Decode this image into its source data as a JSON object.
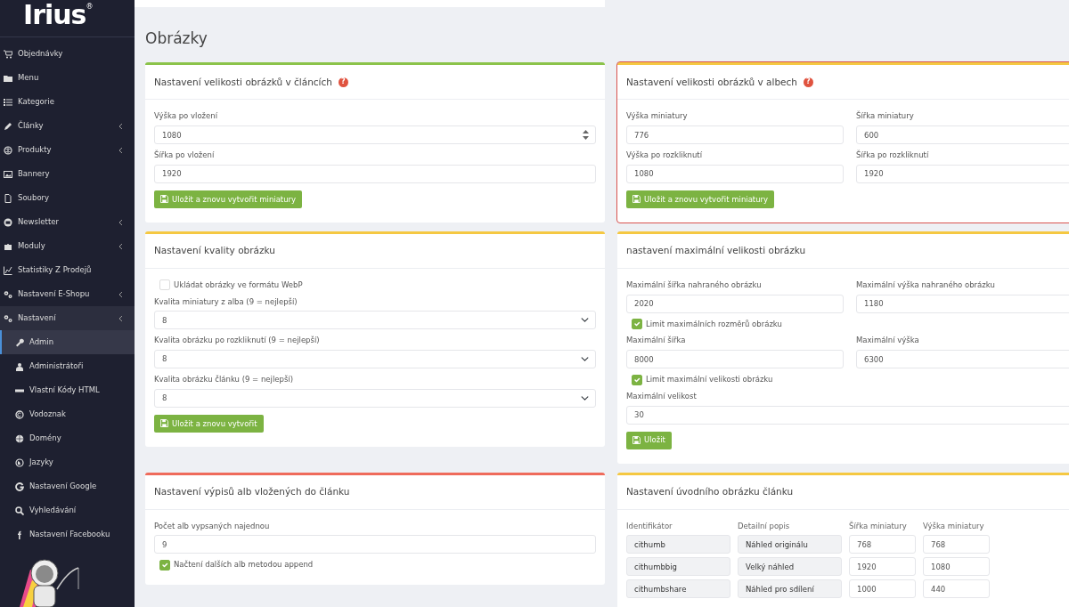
{
  "sidebar": {
    "logo": "Irius",
    "logo_mark": "®",
    "items": [
      {
        "label": "Objednávky",
        "has_submenu": false,
        "expanded": false,
        "selected": false
      },
      {
        "label": "Menu",
        "has_submenu": false,
        "expanded": false,
        "selected": false
      },
      {
        "label": "Kategorie",
        "has_submenu": false,
        "expanded": false,
        "selected": false
      },
      {
        "label": "Články",
        "has_submenu": true,
        "expanded": false,
        "selected": false
      },
      {
        "label": "Produkty",
        "has_submenu": true,
        "expanded": false,
        "selected": false
      },
      {
        "label": "Bannery",
        "has_submenu": false,
        "expanded": false,
        "selected": false
      },
      {
        "label": "Soubory",
        "has_submenu": false,
        "expanded": false,
        "selected": false
      },
      {
        "label": "Newsletter",
        "has_submenu": true,
        "expanded": false,
        "selected": false
      },
      {
        "label": "Moduly",
        "has_submenu": true,
        "expanded": false,
        "selected": false
      },
      {
        "label": "Statistiky Z Prodejů",
        "has_submenu": false,
        "expanded": false,
        "selected": false
      },
      {
        "label": "Nastavení E-Shopu",
        "has_submenu": true,
        "expanded": false,
        "selected": false
      },
      {
        "label": "Nastavení",
        "has_submenu": true,
        "expanded": true,
        "selected": false,
        "children": [
          {
            "label": "Admin",
            "selected": true
          },
          {
            "label": "Administrátoři",
            "selected": false
          },
          {
            "label": "Vlastní Kódy HTML",
            "selected": false
          },
          {
            "label": "Vodoznak",
            "selected": false
          },
          {
            "label": "Domény",
            "selected": false
          },
          {
            "label": "Jazyky",
            "selected": false
          },
          {
            "label": "Nastavení Google",
            "selected": false
          },
          {
            "label": "Vyhledávání",
            "selected": false
          },
          {
            "label": "Nastavení Facebooku",
            "selected": false
          }
        ]
      }
    ]
  },
  "page_title": "Obrázky",
  "cards": [
    {
      "title": "Nastavení velikosti obrázků v článcích",
      "help": "?",
      "color": "#8bc34a",
      "highlighted": false,
      "items": [
        {
          "kind": "number",
          "label": "Výška po vložení",
          "value": "1080"
        },
        {
          "kind": "input",
          "label": "Šířka po vložení",
          "value": "1920"
        },
        {
          "kind": "button",
          "label": "Uložit a znovu vytvořit miniatury"
        }
      ]
    },
    {
      "title": "Nastavení velikosti obrázků v albech",
      "help": "?",
      "color": "#f5c842",
      "highlighted": true,
      "items": [
        {
          "kind": "row",
          "fields": [
            {
              "kind": "input",
              "label": "Výška miniatury",
              "value": "776"
            },
            {
              "kind": "input",
              "label": "Šířka miniatury",
              "value": "600"
            }
          ]
        },
        {
          "kind": "row",
          "fields": [
            {
              "kind": "input",
              "label": "Výška po rozkliknutí",
              "value": "1080"
            },
            {
              "kind": "input",
              "label": "Šířka po rozkliknutí",
              "value": "1920"
            }
          ]
        },
        {
          "kind": "button",
          "label": "Uložit a znovu vytvořit miniatury"
        }
      ]
    },
    {
      "title": "Nastavení kvality obrázku",
      "color": "#f5c842",
      "highlighted": false,
      "items": [
        {
          "kind": "checkbox",
          "label": "Ukládat obrázky ve formátu WebP",
          "checked": false
        },
        {
          "kind": "select",
          "label": "Kvalita miniatury z alba (9 = nejlepší)",
          "value": "8"
        },
        {
          "kind": "select",
          "label": "Kvalita obrázku po rozkliknutí (9 = nejlepší)",
          "value": "8"
        },
        {
          "kind": "select",
          "label": "Kvalita obrázku článku (9 = nejlepší)",
          "value": "8"
        },
        {
          "kind": "button",
          "label": "Uložit a znovu vytvořit"
        }
      ]
    },
    {
      "title": "nastavení maximální velikosti obrázku",
      "color": "#f5c842",
      "highlighted": false,
      "items": [
        {
          "kind": "row",
          "fields": [
            {
              "kind": "input",
              "label": "Maximální šířka nahraného obrázku",
              "value": "2020"
            },
            {
              "kind": "input",
              "label": "Maximální výška nahraného obrázku",
              "value": "1180"
            }
          ]
        },
        {
          "kind": "checkbox",
          "label": "Limit maximálních rozměrů obrázku",
          "checked": true
        },
        {
          "kind": "row",
          "fields": [
            {
              "kind": "input",
              "label": "Maximální šířka",
              "value": "8000"
            },
            {
              "kind": "input",
              "label": "Maximální výška",
              "value": "6300"
            }
          ]
        },
        {
          "kind": "checkbox",
          "label": "Limit maximální velikosti obrázku",
          "checked": true
        },
        {
          "kind": "input",
          "label": "Maximální velikost",
          "value": "30"
        },
        {
          "kind": "button",
          "label": "Uložit"
        }
      ]
    },
    {
      "title": "Nastavení výpisů alb vložených do článku",
      "color": "#ef6b5b",
      "highlighted": false,
      "items": [
        {
          "kind": "input",
          "label": "Počet alb vypsaných najednou",
          "value": "9"
        },
        {
          "kind": "checkbox",
          "label": "Načtení dalších alb metodou append",
          "checked": true
        }
      ]
    },
    {
      "title": "Nastavení úvodního obrázku článku",
      "color": "#f5c842",
      "highlighted": false,
      "items": [
        {
          "kind": "table",
          "columns": [
            "Identifikátor",
            "Detailní popis",
            "Šířka miniatury",
            "Výška miniatury"
          ],
          "rows": [
            [
              "cithumb",
              "Náhled originálu",
              "768",
              "768"
            ],
            [
              "cithumbbig",
              "Velký náhled",
              "1920",
              "1080"
            ],
            [
              "cithumbshare",
              "Náhled pro sdílení",
              "1000",
              "440"
            ]
          ]
        }
      ]
    }
  ]
}
